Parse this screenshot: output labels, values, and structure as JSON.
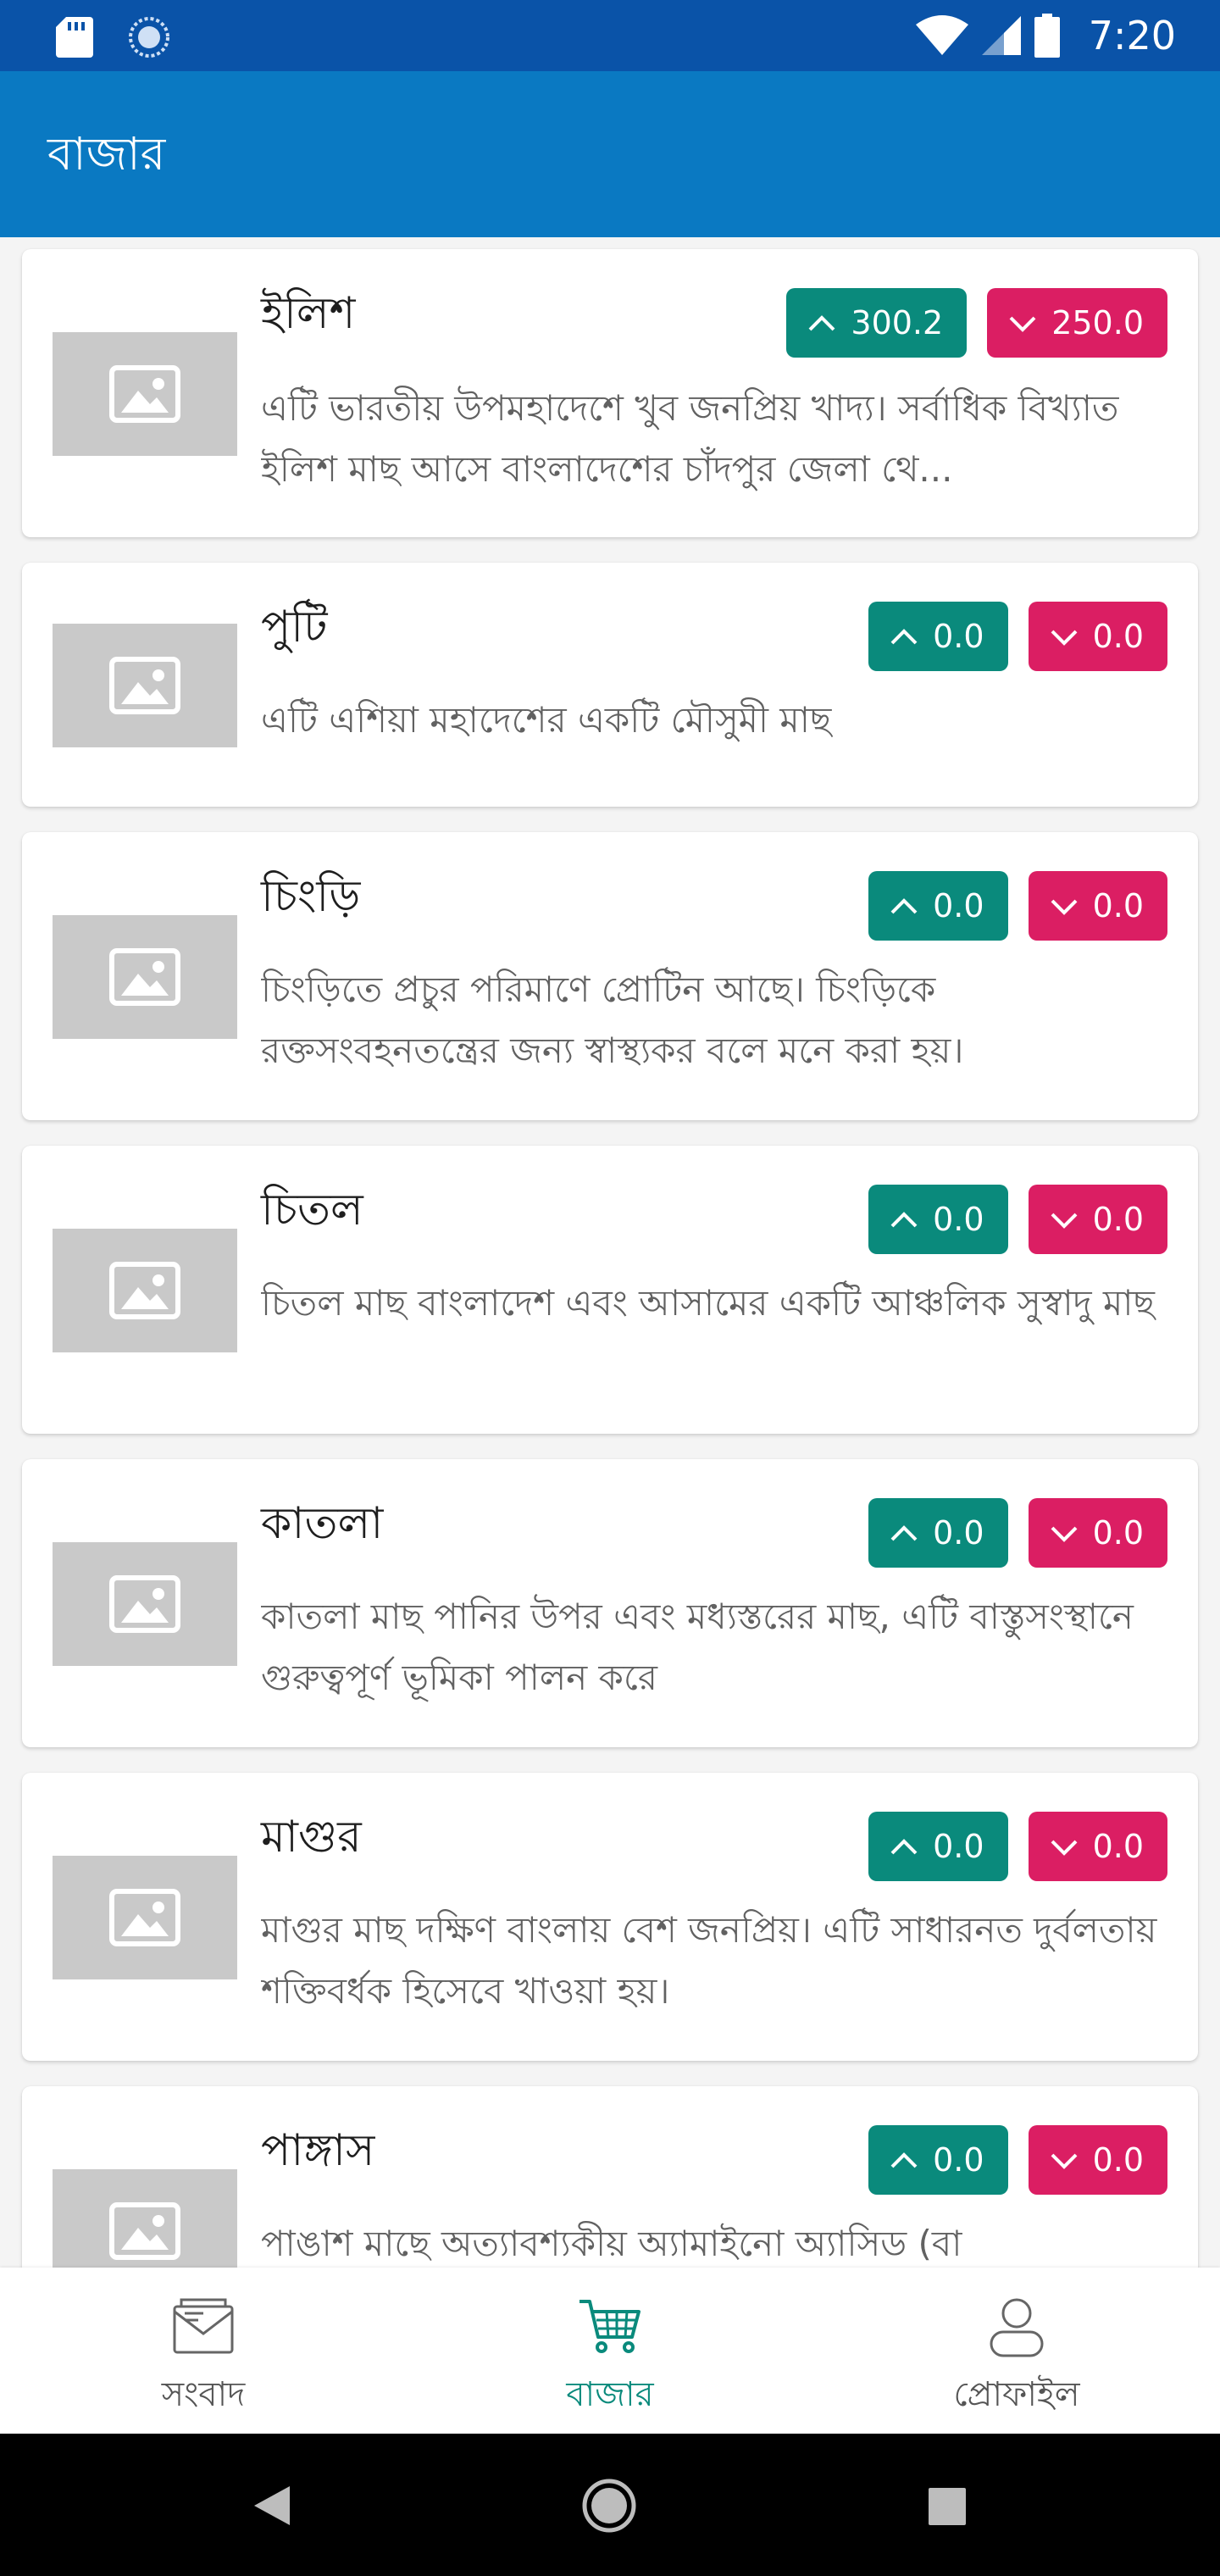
{
  "status_bar": {
    "time": "7:20"
  },
  "app_bar": {
    "title": "বাজার"
  },
  "items": [
    {
      "name": "ইলিশ",
      "up": "300.2",
      "down": "250.0",
      "description": "এটি ভারতীয় উপমহাদেশে খুব জনপ্রিয় খাদ্য। সর্বাধিক বিখ্যাত ইলিশ মাছ আসে বাংলাদেশের চাঁদপুর জেলা থে..."
    },
    {
      "name": "পুটি",
      "up": "0.0",
      "down": "0.0",
      "description": "এটি এশিয়া মহাদেশের একটি মৌসুমী মাছ"
    },
    {
      "name": "চিংড়ি",
      "up": "0.0",
      "down": "0.0",
      "description": "চিংড়িতে প্রচুর পরিমাণে প্রোটিন আছে। চিংড়িকে রক্তসংবহনতন্ত্রের জন্য স্বাস্থ্যকর বলে মনে করা হয়।"
    },
    {
      "name": "চিতল",
      "up": "0.0",
      "down": "0.0",
      "description": "চিতল মাছ বাংলাদেশ এবং আসামের একটি আঞ্চলিক সুস্বাদু মাছ"
    },
    {
      "name": "কাতলা",
      "up": "0.0",
      "down": "0.0",
      "description": "কাতলা মাছ পানির উপর এবং মধ্যস্তরের মাছ, এটি বাস্তুসংস্থানে গুরুত্বপূর্ণ ভূমিকা পালন করে"
    },
    {
      "name": "মাগুর",
      "up": "0.0",
      "down": "0.0",
      "description": "মাগুর মাছ দক্ষিণ বাংলায় বেশ জনপ্রিয়। এটি সাধারনত দুর্বলতায় শক্তিবর্ধক হিসেবে খাওয়া হয়।"
    },
    {
      "name": "পাঙ্গাস",
      "up": "0.0",
      "down": "0.0",
      "description": "পাঙাশ মাছে অত্যাবশ্যকীয় অ্যামাইনো অ্যাসিড (বা"
    }
  ],
  "bottom_nav": {
    "news": "সংবাদ",
    "market": "বাজার",
    "profile": "প্রোফাইল"
  },
  "colors": {
    "status_bar": "#0a53a8",
    "app_bar": "#0a79c2",
    "up_badge": "#0a8a7c",
    "down_badge": "#db1e63",
    "active_nav": "#0a8a7c"
  }
}
